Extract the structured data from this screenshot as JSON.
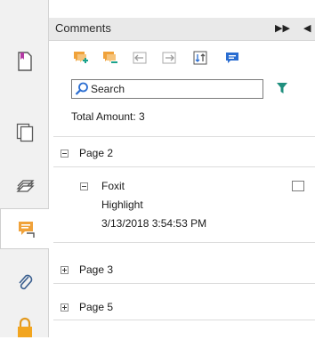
{
  "panel": {
    "title": "Comments"
  },
  "search": {
    "label": "Search"
  },
  "summary": {
    "total": "Total Amount: 3"
  },
  "tree": {
    "pages": [
      {
        "label": "Page 2",
        "expanded": true
      },
      {
        "label": "Page 3",
        "expanded": false
      },
      {
        "label": "Page 5",
        "expanded": false
      }
    ],
    "comment": {
      "author": "Foxit",
      "type": "Highlight",
      "date": "3/13/2018 3:54:53 PM"
    }
  },
  "colors": {
    "accent_orange": "#f0a23a",
    "accent_teal": "#1aa28c",
    "accent_blue": "#2a6dd1",
    "filter_green": "#1f8f7e"
  },
  "icons": [
    "expand-all-comments-icon",
    "collapse-all-comments-icon",
    "import-comments-icon",
    "export-comments-icon",
    "sort-comments-icon",
    "comment-note-icon",
    "search-icon",
    "filter-icon",
    "pages-icon",
    "layers-icon",
    "comments-icon",
    "attachments-icon",
    "security-lock-icon"
  ]
}
